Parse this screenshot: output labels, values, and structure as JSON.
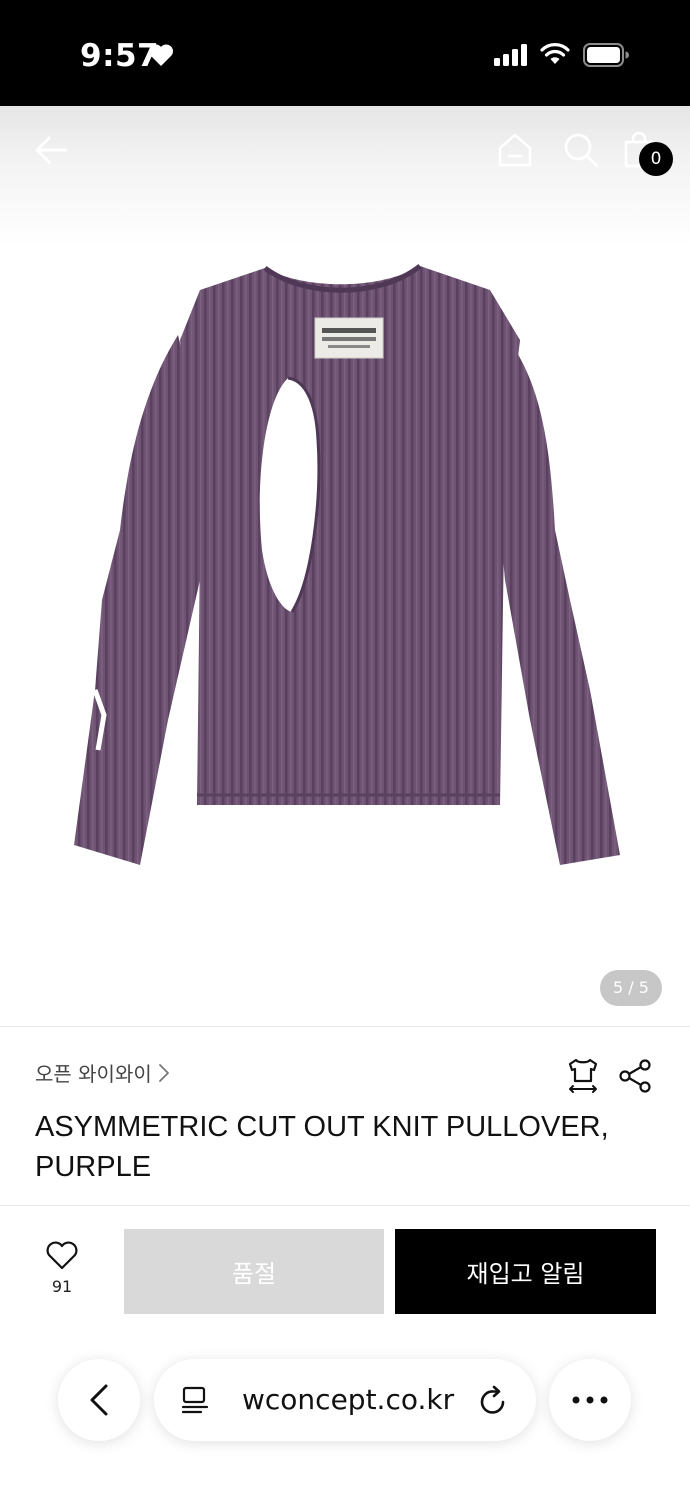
{
  "status_bar": {
    "time": "9:57",
    "icons": [
      "heart-icon",
      "cellular-signal-icon",
      "wifi-icon",
      "battery-icon"
    ]
  },
  "top_nav": {
    "icons": [
      "back-arrow-icon",
      "home-icon",
      "search-icon",
      "shopping-bag-icon"
    ],
    "bag_count": "0"
  },
  "gallery": {
    "counter": "5 / 5",
    "current_image": 5,
    "total_images": 5
  },
  "product": {
    "brand": "오픈 와이와이",
    "title": "ASYMMETRIC CUT OUT KNIT PULLOVER, PURPLE",
    "color": "#6e5373",
    "action_icons": [
      "size-guide-icon",
      "share-icon"
    ]
  },
  "purchase_bar": {
    "like_count": "91",
    "soldout_label": "품절",
    "restock_label": "재입고 알림"
  },
  "browser": {
    "url": "wconcept.co.kr",
    "icons": [
      "back-chevron-icon",
      "reader-icon",
      "reload-icon",
      "more-icon"
    ]
  },
  "colors": {
    "accent": "#000000",
    "disabled_button": "#d9d9d9",
    "sweater": "#6e5373"
  }
}
